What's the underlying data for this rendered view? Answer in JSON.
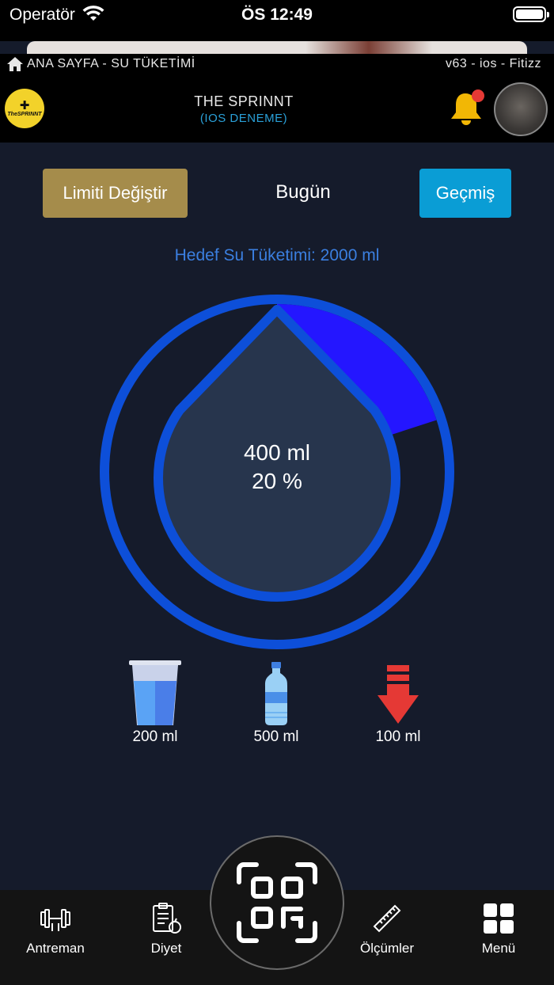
{
  "status_bar": {
    "carrier": "Operatör",
    "time": "ÖS 12:49"
  },
  "breadcrumb": {
    "path": "ANA SAYFA - SU TÜKETİMİ",
    "version": "v63 - ios -  Fitizz"
  },
  "header": {
    "logo_text": "TheSPRINNT",
    "title": "THE SPRINNT",
    "subtitle": "(IOS DENEME)",
    "has_notification": true
  },
  "controls": {
    "limit_button": "Limiti Değiştir",
    "day_label": "Bugün",
    "history_button": "Geçmiş"
  },
  "water": {
    "target_text": "Hedef Su Tüketimi: 2000 ml",
    "target_ml": 2000,
    "consumed_text": "400 ml",
    "percent_text": "20 %",
    "progress_fraction": 0.2,
    "colors": {
      "ring": "#0d4fd9",
      "progress": "#2416ff",
      "drop_fill": "#27354d",
      "background": "#151b2b"
    }
  },
  "quick_add": [
    {
      "icon": "water-glass-icon",
      "label": "200 ml"
    },
    {
      "icon": "water-bottle-icon",
      "label": "500 ml"
    },
    {
      "icon": "red-down-arrow-icon",
      "label": "100 ml"
    }
  ],
  "tabbar": {
    "workout": "Antreman",
    "diet": "Diyet",
    "measurements": "Ölçümler",
    "menu": "Menü",
    "center_icon": "qr-scan-icon"
  }
}
